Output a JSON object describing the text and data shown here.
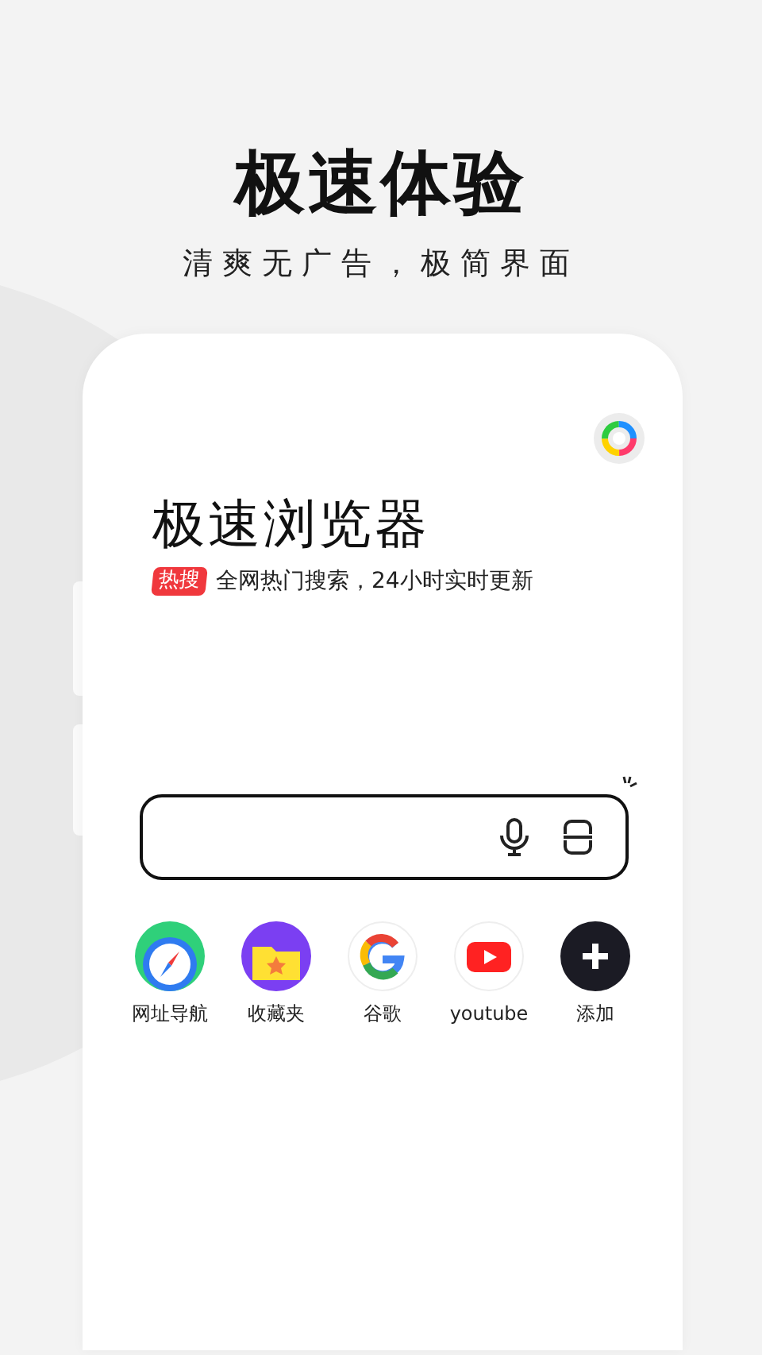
{
  "headline": "极速体验",
  "tagline": "清爽无广告，极简界面",
  "browser": {
    "title": "极速浏览器",
    "hot_badge": "热搜",
    "hot_text": "全网热门搜索，24小时实时更新"
  },
  "shortcuts": [
    {
      "kind": "compass",
      "label": "网址导航"
    },
    {
      "kind": "folder",
      "label": "收藏夹"
    },
    {
      "kind": "google",
      "label": "谷歌"
    },
    {
      "kind": "youtube",
      "label": "youtube"
    },
    {
      "kind": "add",
      "label": "添加"
    }
  ]
}
